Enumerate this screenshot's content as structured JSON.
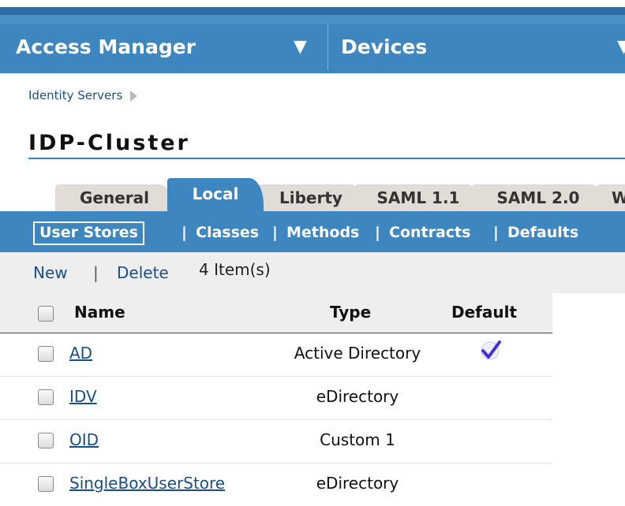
{
  "nav": {
    "items": [
      {
        "label": "Access Manager",
        "arrow": "▼"
      },
      {
        "label": "Devices",
        "arrow": "▼"
      }
    ]
  },
  "breadcrumb": {
    "label": "Identity Servers"
  },
  "page": {
    "title": "IDP-Cluster"
  },
  "tabs": [
    {
      "label": "General"
    },
    {
      "label": "Local",
      "active": true
    },
    {
      "label": "Liberty"
    },
    {
      "label": "SAML 1.1"
    },
    {
      "label": "SAML 2.0"
    },
    {
      "label": "W"
    }
  ],
  "subnav": {
    "items": [
      {
        "label": "User Stores",
        "active": true
      },
      {
        "label": "Classes"
      },
      {
        "label": "Methods"
      },
      {
        "label": "Contracts"
      },
      {
        "label": "Defaults"
      }
    ],
    "separator": "|"
  },
  "actions": {
    "new": "New",
    "separator": "|",
    "delete": "Delete",
    "count": "4 Item(s)"
  },
  "table": {
    "headers": {
      "name": "Name",
      "type": "Type",
      "default": "Default"
    },
    "rows": [
      {
        "name": "AD",
        "type": "Active Directory",
        "default": true
      },
      {
        "name": "IDV",
        "type": "eDirectory",
        "default": false
      },
      {
        "name": "OID",
        "type": "Custom 1",
        "default": false
      },
      {
        "name": "SingleBoxUserStore",
        "type": "eDirectory",
        "default": false
      }
    ]
  },
  "colors": {
    "brand": "#3e86bf",
    "brand_dark": "#2e6da4",
    "link": "#1a4f86",
    "check": "#4b2bd6"
  },
  "icons": {
    "default_marker": "check-icon",
    "breadcrumb_marker": "breadcrumb-arrow-icon"
  }
}
